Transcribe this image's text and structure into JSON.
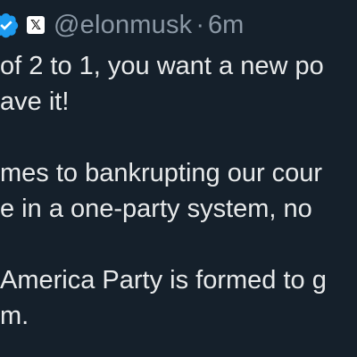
{
  "header": {
    "badge_icon": "x-logo-badge",
    "badge_glyph": "𝕏",
    "handle": "@elonmusk",
    "separator": "·",
    "time": "6m",
    "verified_color": "#1d9bf0"
  },
  "tweet": {
    "lines": [
      "of 2 to 1, you want a new po",
      "ave it!",
      "",
      "mes to bankrupting our cour",
      "e in a one-party system, no",
      "",
      " America Party is formed to g",
      "m."
    ]
  },
  "colors": {
    "background": "#15202b",
    "text": "#e7e9ea",
    "secondary_text": "#8b98a5"
  }
}
